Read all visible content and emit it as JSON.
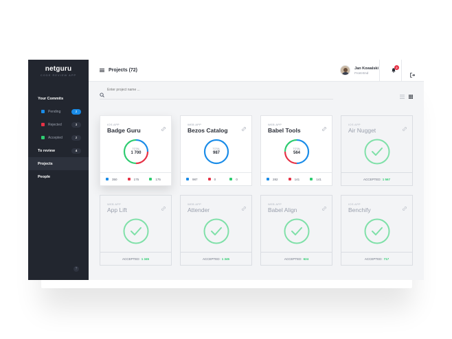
{
  "colors": {
    "sidebar_bg": "#22262f",
    "pending": "#1a8ce8",
    "rejected": "#e63246",
    "accepted": "#2ecc71",
    "check": "#7fe0a8"
  },
  "sidebar": {
    "brand": "netguru",
    "brand_sub": "CODE REVIEW APP",
    "commits_title": "Your Commits",
    "commits": [
      {
        "label": "Pending",
        "count": "2"
      },
      {
        "label": "Rejected",
        "count": "3"
      },
      {
        "label": "Accepted",
        "count": "2"
      }
    ],
    "items": [
      {
        "label": "To review",
        "count": "4"
      },
      {
        "label": "Projects"
      },
      {
        "label": "People"
      }
    ],
    "help": "?"
  },
  "topbar": {
    "title": "Projects (72)",
    "user_name": "Jan Kowalski",
    "user_role": "Front-End",
    "notifications": "2"
  },
  "search": {
    "placeholder": "Enter project name ..."
  },
  "projects": [
    {
      "type": "IOS APP",
      "title": "Badge Guru",
      "total_label": "TOTAL",
      "total": "1 700",
      "pending": "350",
      "rejected": "175",
      "accepted": "175",
      "ring": [
        0.25,
        0.25,
        0.5
      ]
    },
    {
      "type": "WEB APP",
      "title": "Bezos Catalog",
      "total_label": "TOTAL",
      "total": "987",
      "pending": "987",
      "rejected": "0",
      "accepted": "0",
      "ring": [
        1,
        0,
        0
      ]
    },
    {
      "type": "WEB APP",
      "title": "Babel Tools",
      "total_label": "TOTAL",
      "total": "564",
      "pending": "282",
      "rejected": "141",
      "accepted": "141",
      "ring": [
        0.5,
        0.25,
        0.25
      ]
    },
    {
      "type": "IOS APP",
      "title": "Air Nugget",
      "accepted_label": "ACCEPTED:",
      "accepted": "1 567"
    },
    {
      "type": "WEB APP",
      "title": "App Lift",
      "accepted_label": "ACCEPTED:",
      "accepted": "1 345"
    },
    {
      "type": "WEB APP",
      "title": "Attender",
      "accepted_label": "ACCEPTED:",
      "accepted": "1 345"
    },
    {
      "type": "WEB APP",
      "title": "Babel Align",
      "accepted_label": "ACCEPTED:",
      "accepted": "624"
    },
    {
      "type": "IOS APP",
      "title": "Benchify",
      "accepted_label": "ACCEPTED:",
      "accepted": "717"
    }
  ]
}
